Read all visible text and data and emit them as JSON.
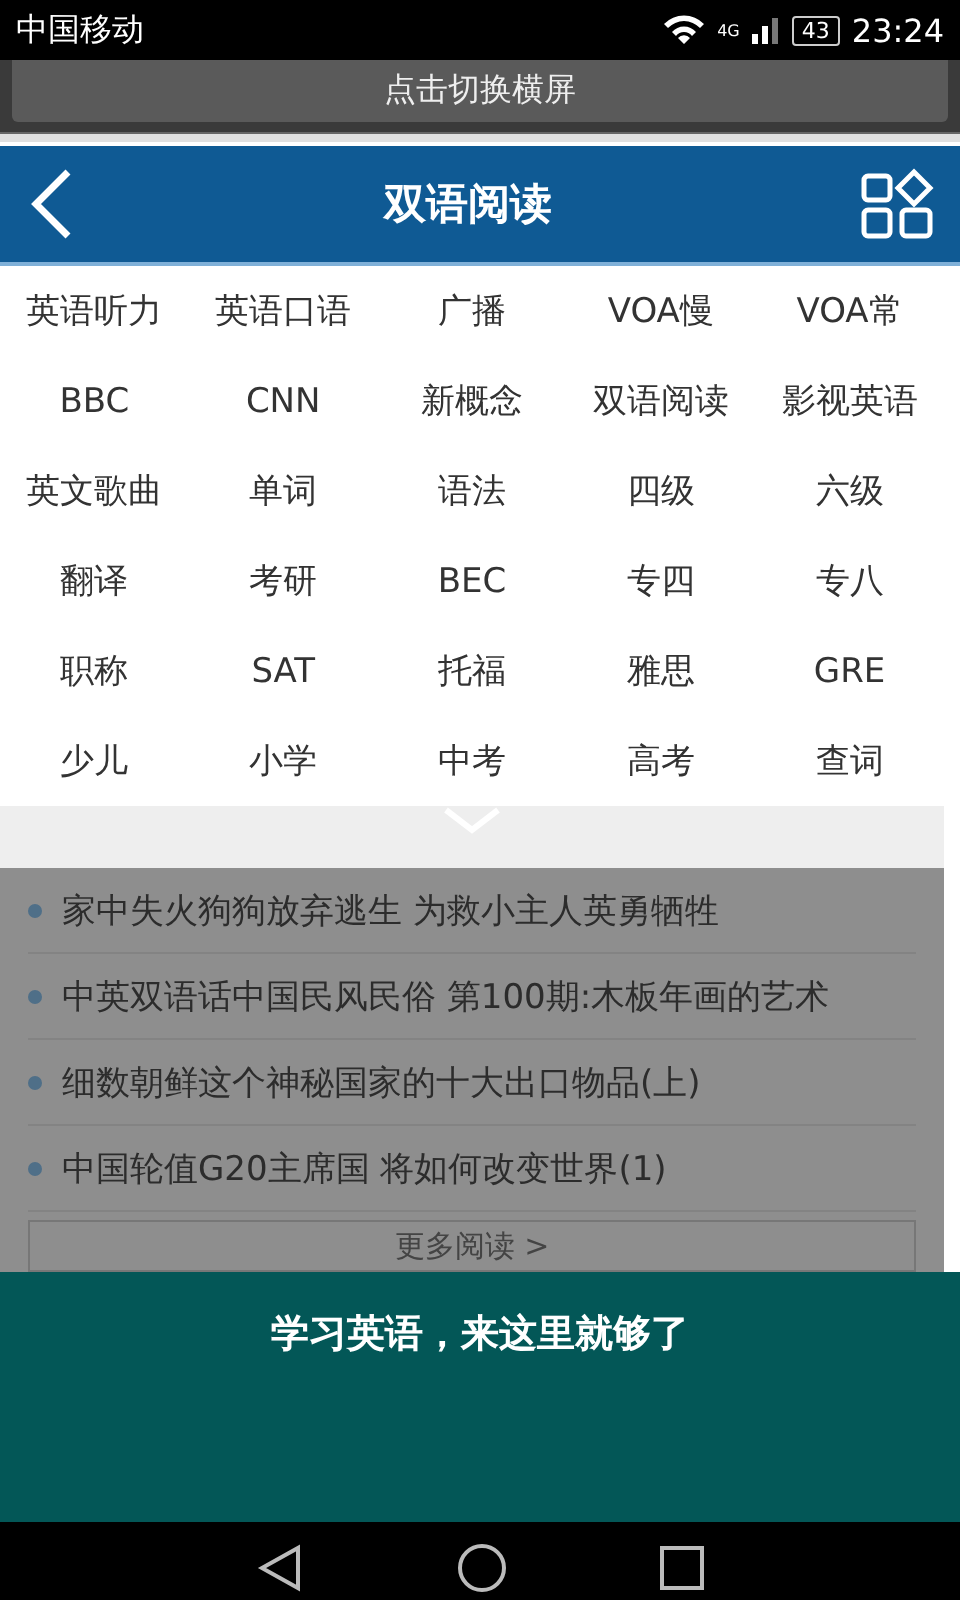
{
  "status_bar": {
    "carrier": "中国移动",
    "network": "4G",
    "battery": "43",
    "time": "23:24"
  },
  "rotate_hint": "点击切换横屏",
  "header": {
    "title": "双语阅读"
  },
  "categories": [
    "英语听力",
    "英语口语",
    "广播",
    "VOA慢",
    "VOA常",
    "BBC",
    "CNN",
    "新概念",
    "双语阅读",
    "影视英语",
    "英文歌曲",
    "单词",
    "语法",
    "四级",
    "六级",
    "翻译",
    "考研",
    "BEC",
    "专四",
    "专八",
    "职称",
    "SAT",
    "托福",
    "雅思",
    "GRE",
    "少儿",
    "小学",
    "中考",
    "高考",
    "查词"
  ],
  "articles": [
    "家中失火狗狗放弃逃生 为救小主人英勇牺牲",
    "中英双语话中国民风民俗 第100期:木板年画的艺术",
    "细数朝鲜这个神秘国家的十大出口物品(上)",
    "中国轮值G20主席国 将如何改变世界(1)"
  ],
  "more_button": "更多阅读 >",
  "banner": {
    "text": "学习英语，来这里就够了"
  }
}
